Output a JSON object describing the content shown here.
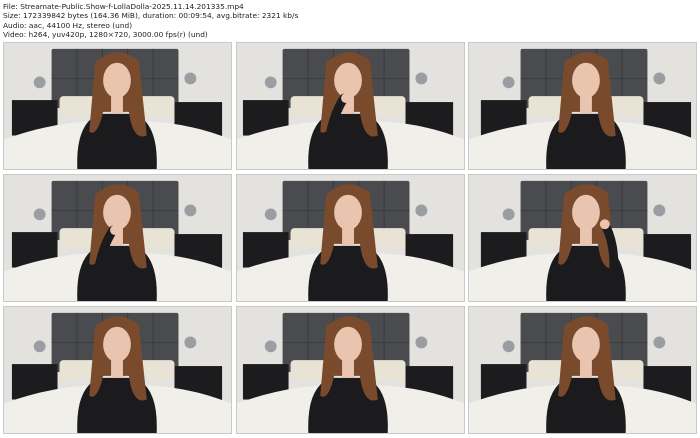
{
  "header": {
    "file": "File: Streamate-Public.Show-f-LollaDolla-2025.11.14.201335.mp4",
    "size": "Size: 172339842 bytes (164.36 MiB), duration: 00:09:54, avg.bitrate: 2321 kb/s",
    "audio": "Audio: aac, 44100 Hz, stereo (und)",
    "video": "Video: h264, yuv420p, 1280×720, 3000.00 fps(r) (und)"
  },
  "thumbnails": [
    {
      "pose": "neutral"
    },
    {
      "pose": "hand-at-mouth"
    },
    {
      "pose": "neutral"
    },
    {
      "pose": "hand-at-chin"
    },
    {
      "pose": "neutral"
    },
    {
      "pose": "hand-in-hair"
    },
    {
      "pose": "neutral"
    },
    {
      "pose": "neutral"
    },
    {
      "pose": "neutral"
    }
  ],
  "colors": {
    "wall": "#e4e2df",
    "headboard": "#4a4b4f",
    "bedding": "#f1efea",
    "pillow": "#e9e3d6",
    "nightstand": "#1c1c1e",
    "hair": "#7a4a2c",
    "skin": "#e9c4ae",
    "top": "#1b1b1d"
  }
}
